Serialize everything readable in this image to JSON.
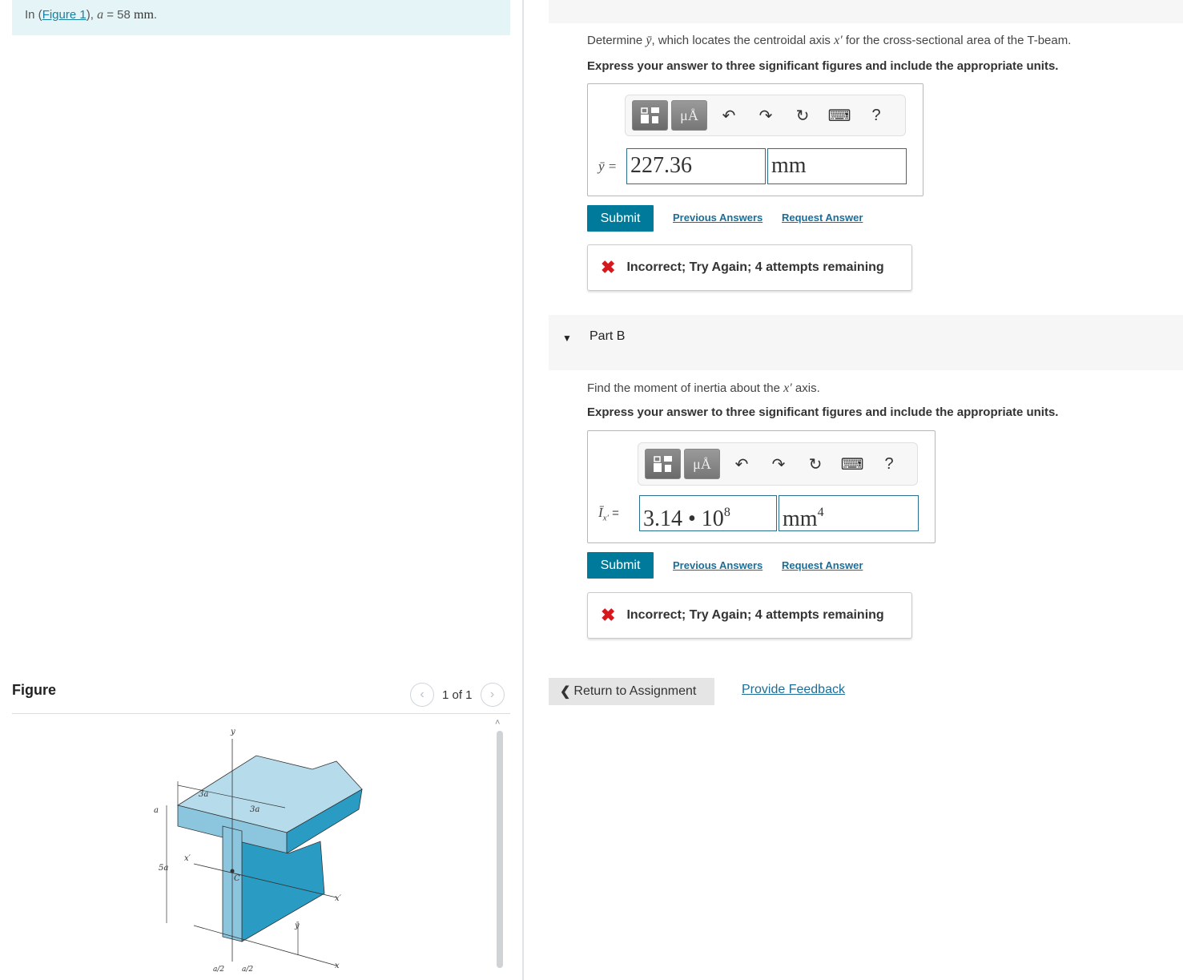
{
  "intro": {
    "prefix": "In (",
    "figure_link": "Figure 1",
    "middle": "), ",
    "var": "a",
    "equals": " = 58 ",
    "unit": "mm",
    "end": "."
  },
  "part_a": {
    "question_pre": "Determine ",
    "question_var": "ȳ",
    "question_mid": ", which locates the centroidal axis ",
    "question_axis": "x′",
    "question_post": " for the cross-sectional area of the T-beam.",
    "instruction": "Express your answer to three significant figures and include the appropriate units.",
    "eq_label": "ȳ =",
    "value": "227.36",
    "units": "mm",
    "submit": "Submit",
    "previous_answers": "Previous Answers",
    "request_answer": "Request Answer",
    "feedback": "Incorrect; Try Again; 4 attempts remaining"
  },
  "part_b": {
    "title": "Part B",
    "question_pre": "Find the moment of inertia about the ",
    "question_axis": "x′",
    "question_post": " axis.",
    "instruction": "Express your answer to three significant figures and include the appropriate units.",
    "eq_label": "Ī",
    "eq_sub": "x′",
    "eq_eq": " =",
    "value_mantissa": "3.14 • 10",
    "value_exp": "8",
    "units": "mm",
    "units_exp": "4",
    "submit": "Submit",
    "previous_answers": "Previous Answers",
    "request_answer": "Request Answer",
    "feedback": "Incorrect; Try Again; 4 attempts remaining"
  },
  "toolbar": {
    "mu_label": "μÅ",
    "help": "?"
  },
  "figure": {
    "title": "Figure",
    "pagination": "1 of 1",
    "labels": {
      "y": "y",
      "three_a_left": "3a",
      "three_a_right": "3a",
      "a": "a",
      "five_a": "5a",
      "x_prime_left": "x′",
      "c": "C",
      "x_prime_right": "x′",
      "y_bar": "ȳ",
      "x": "x",
      "a_over_2_left": "a/2",
      "a_over_2_right": "a/2"
    }
  },
  "footer": {
    "return": "Return to Assignment",
    "provide_feedback": "Provide Feedback"
  }
}
